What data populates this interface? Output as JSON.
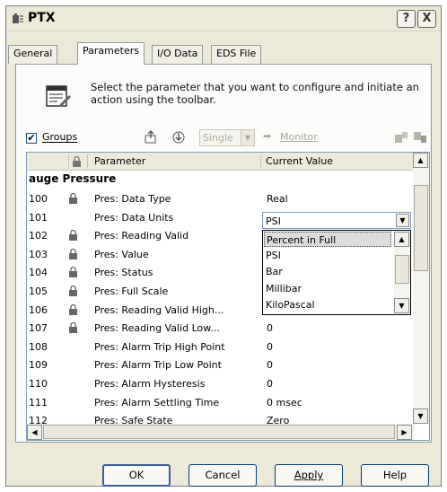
{
  "window": {
    "title": "PTX",
    "help_label": "?",
    "close_label": "X"
  },
  "tabs": [
    {
      "label": "General"
    },
    {
      "label": "Parameters"
    },
    {
      "label": "I/O Data"
    },
    {
      "label": "EDS File"
    }
  ],
  "description": "Select the parameter that you want to configure and initiate an action using the toolbar.",
  "toolbar": {
    "groups_label": "Groups",
    "groups_checked": true,
    "mode_value": "Single",
    "monitor_label": "Monitor"
  },
  "grid": {
    "columns": [
      "Parameter",
      "Current Value"
    ],
    "group_name": "auge Pressure",
    "rows": [
      {
        "id": "100",
        "locked": true,
        "name": "Pres: Data Type",
        "value": "Real"
      },
      {
        "id": "101",
        "locked": false,
        "name": "Pres: Data Units",
        "value": "PSI"
      },
      {
        "id": "102",
        "locked": true,
        "name": "Pres: Reading Valid",
        "value": ""
      },
      {
        "id": "103",
        "locked": true,
        "name": "Pres: Value",
        "value": ""
      },
      {
        "id": "104",
        "locked": true,
        "name": "Pres: Status",
        "value": ""
      },
      {
        "id": "105",
        "locked": true,
        "name": "Pres: Full Scale",
        "value": ""
      },
      {
        "id": "106",
        "locked": true,
        "name": "Pres: Reading Valid High...",
        "value": ""
      },
      {
        "id": "107",
        "locked": true,
        "name": "Pres: Reading Valid Low...",
        "value": "0"
      },
      {
        "id": "108",
        "locked": false,
        "name": "Pres: Alarm Trip High Point",
        "value": "0"
      },
      {
        "id": "109",
        "locked": false,
        "name": "Pres: Alarm Trip Low Point",
        "value": "0"
      },
      {
        "id": "110",
        "locked": false,
        "name": "Pres: Alarm Hysteresis",
        "value": "0"
      },
      {
        "id": "111",
        "locked": false,
        "name": "Pres: Alarm Settling Time",
        "value": "0 msec"
      },
      {
        "id": "112",
        "locked": false,
        "name": "Pres: Safe State",
        "value": "Zero"
      }
    ],
    "editor_value": "PSI",
    "dropdown_options": [
      "Percent in Full",
      "PSI",
      "Bar",
      "Millibar",
      "KiloPascal"
    ],
    "dropdown_selected": "Percent in Full"
  },
  "buttons": {
    "ok": "OK",
    "cancel": "Cancel",
    "apply": "Apply",
    "help": "Help"
  }
}
